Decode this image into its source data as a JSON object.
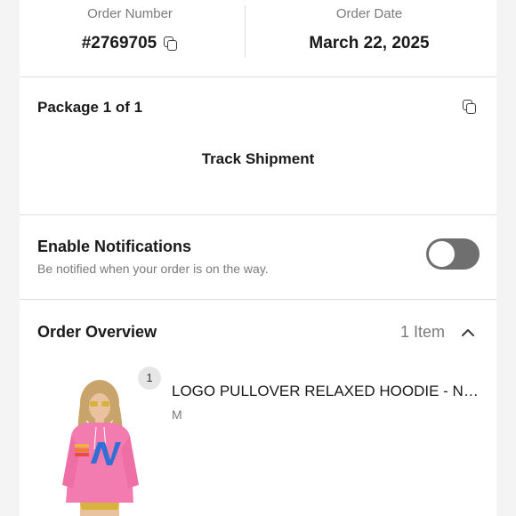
{
  "order": {
    "number_label": "Order Number",
    "number_value": "#2769705",
    "date_label": "Order Date",
    "date_value": "March 22, 2025"
  },
  "package": {
    "title": "Package 1 of 1",
    "track_label": "Track Shipment"
  },
  "notifications": {
    "title": "Enable Notifications",
    "subtitle": "Be notified when your order is on the way.",
    "enabled": false
  },
  "overview": {
    "title": "Order Overview",
    "item_count": "1 Item",
    "items": [
      {
        "quantity": "1",
        "name": "LOGO PULLOVER RELAXED HOODIE - NEON PINK",
        "size": "M"
      }
    ]
  },
  "colors": {
    "background": "#f4f4f4",
    "card": "#ffffff",
    "toggle_off": "#6f6f6f",
    "hoodie": "#f27bb0",
    "logo_blue": "#2f6fd6"
  }
}
